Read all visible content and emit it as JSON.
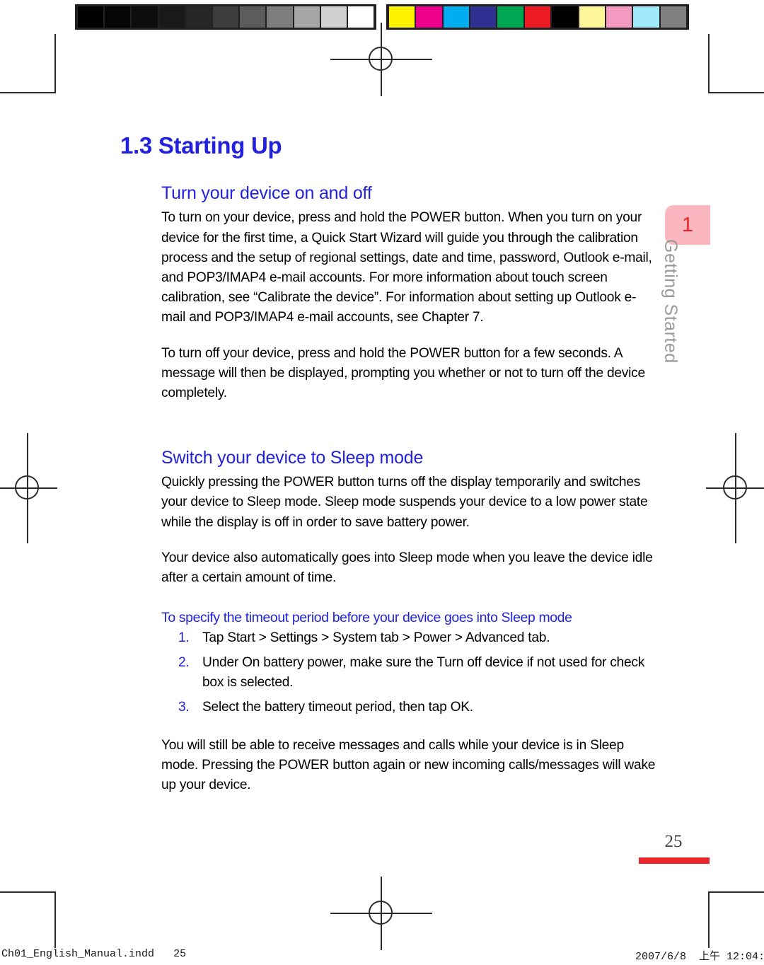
{
  "document": {
    "chapter_title": "1.3 Starting Up",
    "page_number": "25",
    "thumb_tab_number": "1",
    "thumb_tab_label": "Getting Started"
  },
  "colors": {
    "heading_blue": "#2222dd",
    "accent_red": "#e8262b",
    "tab_pink": "#fbb7bf",
    "thumb_label_gray": "#9a9a9a",
    "body_black": "#000000"
  },
  "sections": [
    {
      "heading": "Turn your device on and off",
      "paragraphs": [
        "To turn on your device, press and hold the POWER button. When you turn on your device for the first time, a Quick Start Wizard will guide you through the calibration process and the setup of regional settings, date and time, password, Outlook e-mail, and POP3/IMAP4 e-mail accounts. For more information about touch screen calibration, see “Calibrate the device”. For information about setting up Outlook e-mail and POP3/IMAP4 e-mail accounts, see Chapter 7.",
        "To turn off your device, press and hold the POWER button for a few seconds. A message will then be displayed, prompting you whether or not to turn off the device completely."
      ]
    },
    {
      "heading": "Switch your device to Sleep mode",
      "paragraphs": [
        "Quickly pressing the POWER button turns off the display temporarily and switches your device to Sleep mode. Sleep mode suspends your device to a low power state while the display is off in order to save battery power.",
        "Your device also automatically goes into Sleep mode when you leave the device idle after a certain amount of time."
      ],
      "subsection": {
        "heading": "To specify the timeout period before your device goes into Sleep mode",
        "steps": [
          {
            "num": "1.",
            "text": "Tap Start > Settings > System tab > Power > Advanced tab."
          },
          {
            "num": "2.",
            "text": "Under On battery power, make sure the Turn off device if not used for check box is selected."
          },
          {
            "num": "3.",
            "text": "Select the battery timeout period, then tap OK."
          }
        ]
      },
      "closing_paragraph": "You will still be able to receive messages and calls while your device is in Sleep mode. Pressing the POWER button again or new incoming calls/messages will wake up your device."
    }
  ],
  "print_marks": {
    "grey_ramp": [
      "#000000",
      "#050505",
      "#0d0d0d",
      "#1a1a1a",
      "#262626",
      "#3d3d3d",
      "#5c5c5c",
      "#7d7d7d",
      "#a6a6a6",
      "#d1d1d1",
      "#ffffff"
    ],
    "color_patches": [
      "#fff200",
      "#ec008c",
      "#00aeef",
      "#2e3192",
      "#00a651",
      "#ed1c24",
      "#000000",
      "#fff799",
      "#f49ac1",
      "#a1e9fa",
      "#808080"
    ]
  },
  "footer": {
    "file_name": "Ch01_English_Manual.indd",
    "file_page": "25",
    "date": "2007/6/8",
    "time": "上午 12:04:"
  }
}
